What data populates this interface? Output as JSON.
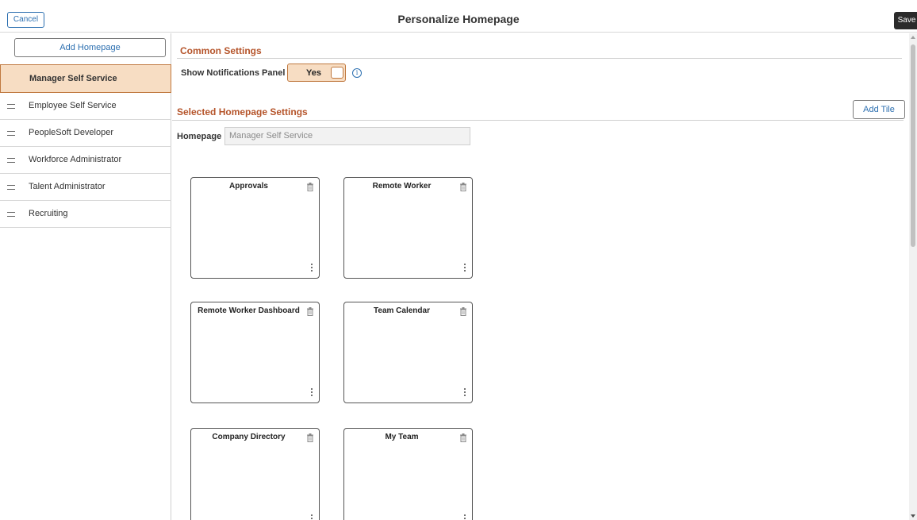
{
  "header": {
    "title": "Personalize Homepage",
    "cancel_label": "Cancel",
    "save_label": "Save"
  },
  "sidebar": {
    "add_homepage_label": "Add Homepage",
    "items": [
      {
        "label": "Manager Self Service",
        "selected": true
      },
      {
        "label": "Employee Self Service",
        "selected": false
      },
      {
        "label": "PeopleSoft Developer",
        "selected": false
      },
      {
        "label": "Workforce Administrator",
        "selected": false
      },
      {
        "label": "Talent Administrator",
        "selected": false
      },
      {
        "label": "Recruiting",
        "selected": false
      }
    ]
  },
  "common_settings": {
    "title": "Common Settings",
    "notifications_label": "Show Notifications Panel",
    "notifications_value": "Yes",
    "info_icon": "i"
  },
  "selected_settings": {
    "title": "Selected Homepage Settings",
    "add_tile_label": "Add Tile",
    "homepage_label": "Homepage",
    "homepage_value": "Manager Self Service"
  },
  "tiles": [
    {
      "title": "Approvals"
    },
    {
      "title": "Remote Worker"
    },
    {
      "title": "Remote Worker Dashboard"
    },
    {
      "title": "Team Calendar"
    },
    {
      "title": "Company Directory"
    },
    {
      "title": "My Team"
    }
  ],
  "colors": {
    "accent_orange": "#b5542a",
    "selected_bg": "#f7ddc3",
    "link_blue": "#2c6fb0"
  }
}
